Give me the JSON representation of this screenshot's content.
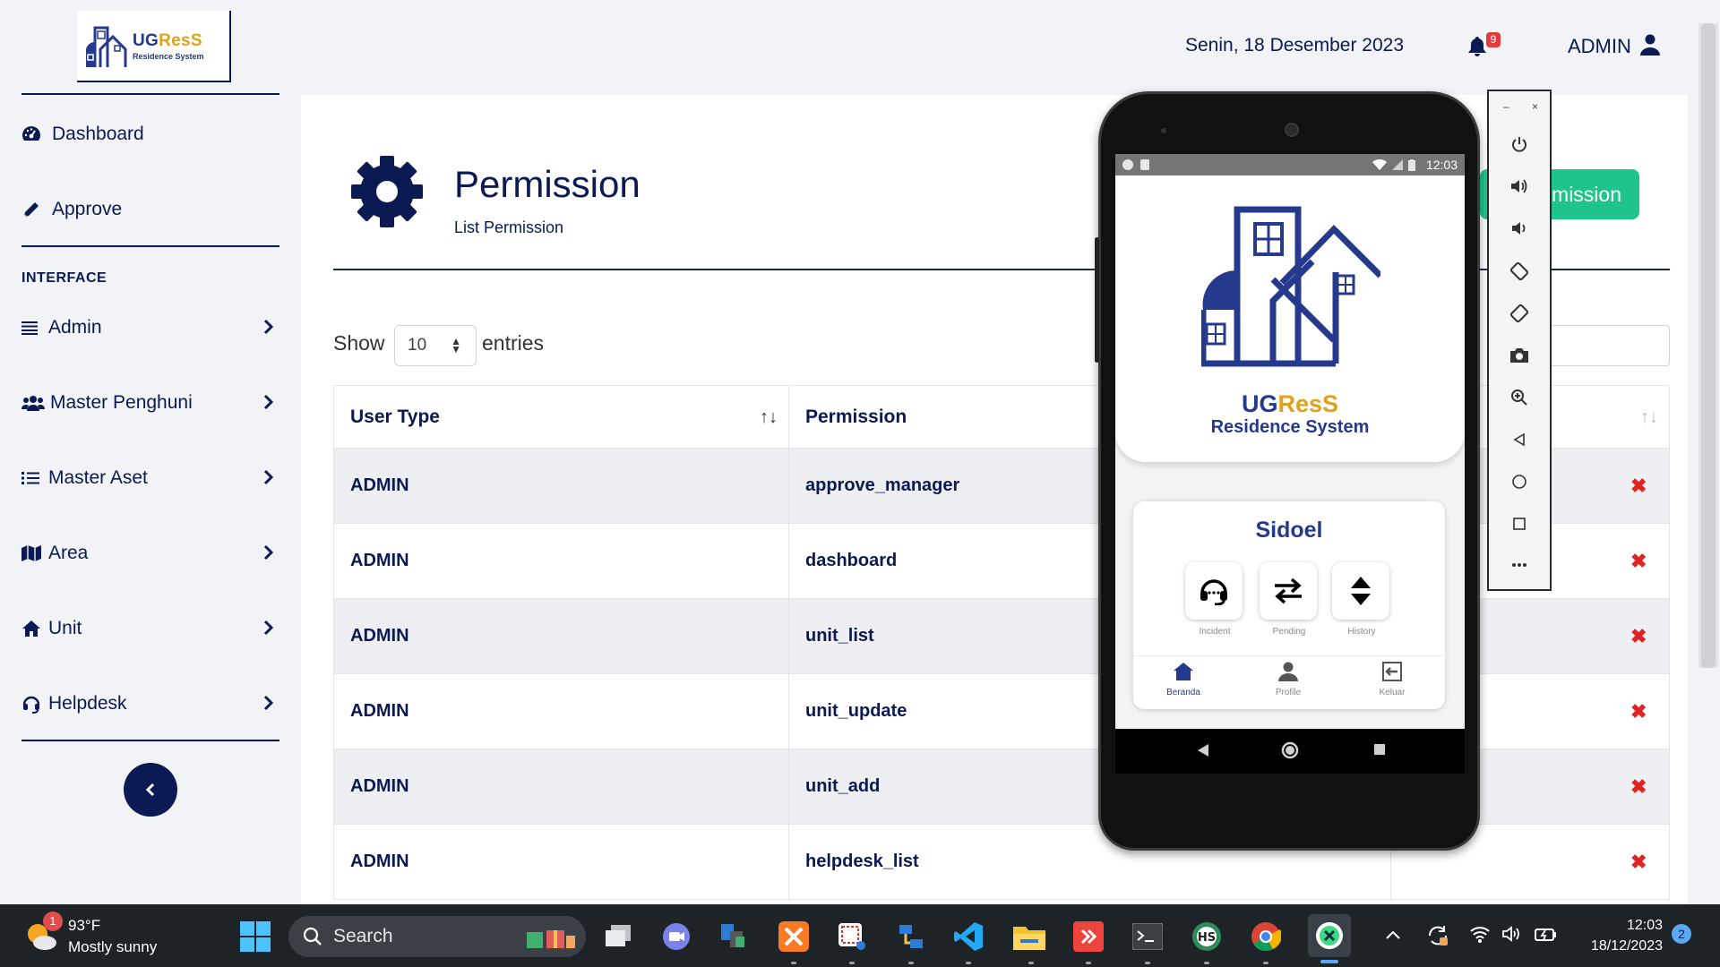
{
  "brand": {
    "name_part1": "UG",
    "name_part2": "ResS",
    "tagline": "Residence System"
  },
  "topbar": {
    "date": "Senin, 18 Desember 2023",
    "notification_count": "9",
    "user_label": "ADMIN"
  },
  "sidebar": {
    "items": [
      {
        "label": "Dashboard",
        "icon": "dashboard-icon"
      },
      {
        "label": "Approve",
        "icon": "pencil-icon"
      }
    ],
    "section_heading": "INTERFACE",
    "menu": [
      {
        "label": "Admin",
        "icon": "list-icon"
      },
      {
        "label": "Master Penghuni",
        "icon": "users-icon"
      },
      {
        "label": "Master Aset",
        "icon": "list-ul-icon"
      },
      {
        "label": "Area",
        "icon": "map-icon"
      },
      {
        "label": "Unit",
        "icon": "home-icon"
      },
      {
        "label": "Helpdesk",
        "icon": "headset-icon"
      }
    ]
  },
  "page": {
    "title": "Permission",
    "subtitle": "List Permission",
    "add_button_visible": "mission"
  },
  "table_controls": {
    "show_label": "Show",
    "entries_value": "10",
    "entries_label": "entries"
  },
  "table": {
    "columns": [
      "User Type",
      "Permission"
    ],
    "rows": [
      {
        "user_type": "ADMIN",
        "permission": "approve_manager"
      },
      {
        "user_type": "ADMIN",
        "permission": "dashboard"
      },
      {
        "user_type": "ADMIN",
        "permission": "unit_list"
      },
      {
        "user_type": "ADMIN",
        "permission": "unit_update"
      },
      {
        "user_type": "ADMIN",
        "permission": "unit_add"
      },
      {
        "user_type": "ADMIN",
        "permission": "helpdesk_list"
      }
    ],
    "delete_glyph": "✖"
  },
  "emulator": {
    "status_time": "12:03",
    "app_brand_part1": "UG",
    "app_brand_part2": "ResS",
    "app_tagline": "Residence System",
    "user_name": "Sidoel",
    "actions": [
      {
        "label": "Incident",
        "icon": "headset-icon"
      },
      {
        "label": "Pending",
        "icon": "swap-icon"
      },
      {
        "label": "History",
        "icon": "sort-icon"
      }
    ],
    "bottom_nav": [
      {
        "label": "Beranda",
        "icon": "home-icon"
      },
      {
        "label": "Profile",
        "icon": "user-icon"
      },
      {
        "label": "Keluar",
        "icon": "logout-icon"
      }
    ],
    "toolbar": [
      "power-icon",
      "volume-up-icon",
      "volume-down-icon",
      "rotate-left-icon",
      "rotate-right-icon",
      "camera-icon",
      "zoom-icon",
      "back-icon",
      "home-icon",
      "overview-icon",
      "more-icon"
    ]
  },
  "taskbar": {
    "weather_temp": "93°F",
    "weather_desc": "Mostly sunny",
    "weather_badge": "1",
    "search_placeholder": "Search",
    "time": "12:03",
    "date": "18/12/2023",
    "notification_count": "2"
  },
  "colors": {
    "navy": "#0b1a52",
    "accent_green": "#1fc48a",
    "danger": "#e02424",
    "app_blue": "#253a8c",
    "gold": "#e0a11b"
  }
}
